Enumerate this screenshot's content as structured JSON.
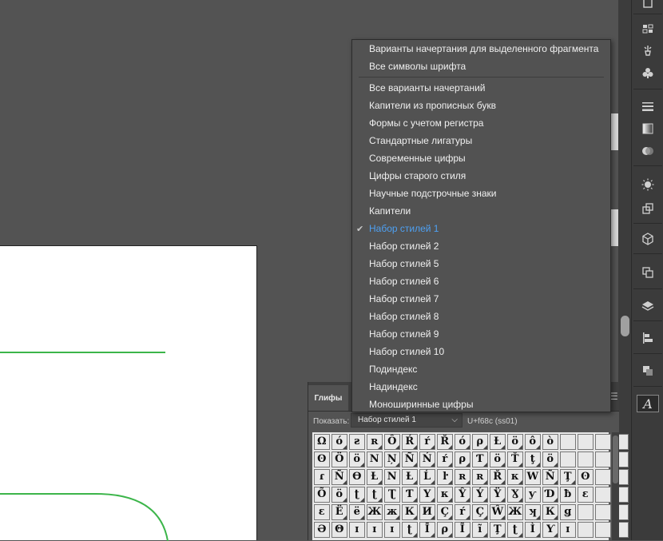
{
  "menu": {
    "items": [
      {
        "label": "Варианты начертания для выделенного фрагмента"
      },
      {
        "label": "Все символы шрифта"
      },
      {
        "label": "Все варианты начертаний"
      },
      {
        "label": "Капители из прописных букв"
      },
      {
        "label": "Формы с учетом регистра"
      },
      {
        "label": "Стандартные лигатуры"
      },
      {
        "label": "Современные цифры"
      },
      {
        "label": "Цифры старого стиля"
      },
      {
        "label": "Научные подстрочные знаки"
      },
      {
        "label": "Капители"
      },
      {
        "label": "Набор стилей 1",
        "checked": true
      },
      {
        "label": "Набор стилей 2"
      },
      {
        "label": "Набор стилей 5"
      },
      {
        "label": "Набор стилей 6"
      },
      {
        "label": "Набор стилей 7"
      },
      {
        "label": "Набор стилей 8"
      },
      {
        "label": "Набор стилей 9"
      },
      {
        "label": "Набор стилей 10"
      },
      {
        "label": "Подиндекс"
      },
      {
        "label": "Надиндекс"
      },
      {
        "label": "Моноширинные цифры"
      }
    ],
    "check_glyph": "✔",
    "accent_color": "#4ea0f2"
  },
  "glyphs_panel": {
    "tab_label": "Глифы",
    "show_label": "Показать:",
    "show_value": "Набор стилей 1",
    "unicode_info": "U+f68c (ss01)",
    "rows": [
      [
        "Ω",
        "ó",
        "ƨ",
        "ʀ",
        "Ô",
        "Ŕ",
        "ŕ",
        "Ř",
        "ó",
        "ρ",
        "Ƚ",
        "ö",
        "ô",
        "ò"
      ],
      [
        "ʘ",
        "Ö",
        "ö",
        "Ν",
        "Ņ",
        "Ñ",
        "Ń",
        "ŕ",
        "ρ",
        "Ƭ",
        "ö",
        "Ť",
        "ţ",
        "ö"
      ],
      [
        "ɾ",
        "Ñ",
        "Ѳ",
        "Ƚ",
        "Ν",
        "Ƚ",
        "Ĺ",
        "ŀ",
        "ʀ",
        "ʀ",
        "Ř",
        "κ",
        "W",
        "Ñ",
        "Ţ",
        "ʘ"
      ],
      [
        "Õ",
        "ö",
        "ʈ",
        "ʈ",
        "Ʈ",
        "Ƭ",
        "Υ",
        "κ",
        "Ŷ",
        "Ý",
        "Ÿ",
        "Ɣ",
        "ƴ",
        "Ɗ",
        "ƀ",
        "ɛ"
      ],
      [
        "ɛ",
        "Ë",
        "ë",
        "Ж",
        "ж",
        "К",
        "И",
        "Ç",
        "ŕ",
        "Ç",
        "Ŵ",
        "Ж",
        "ʞ",
        "К",
        "ǥ"
      ],
      [
        "Ə",
        "Θ",
        "ɪ",
        "ɪ",
        "ɪ",
        "ʈ",
        "Ī",
        "ρ",
        "Ĩ",
        "ĩ",
        "Ţ",
        "ʈ",
        "Ì",
        "Ƴ",
        "ɪ"
      ]
    ],
    "marked": [
      "ó",
      "ʀ",
      "Ô",
      "Ŕ",
      "ŕ",
      "Ř",
      "ó",
      "ρ",
      "Ƚ",
      "ö",
      "ô",
      "Ņ",
      "Ñ",
      "Ń",
      "ŕ",
      "Ƭ",
      "Ť",
      "ţ",
      "Ĺ",
      "ŀ",
      "Ř",
      "κ",
      "Ţ",
      "Ƭ",
      "Υ",
      "κ",
      "Ŷ",
      "Ý",
      "Ÿ",
      "Ɣ",
      "Ɗ",
      "Ë",
      "ë",
      "ж",
      "К",
      "И",
      "Ç",
      "Ŵ",
      "ʞ",
      "Ī",
      "Ĩ",
      "ĩ",
      "ʈ",
      "Ì",
      "Ƴ"
    ]
  },
  "tools": [
    {
      "name": "libraries-icon"
    },
    {
      "name": "swatches-grid-icon"
    },
    {
      "name": "brush-icon"
    },
    {
      "name": "club-symbol-icon"
    },
    {
      "name": "stroke-lines-icon"
    },
    {
      "name": "gradient-icon"
    },
    {
      "name": "transparency-icon"
    },
    {
      "name": "appearance-sun-icon"
    },
    {
      "name": "graphic-styles-icon"
    },
    {
      "name": "3d-cube-icon"
    },
    {
      "name": "artboards-icon"
    },
    {
      "name": "layers-icon"
    },
    {
      "name": "align-icon"
    },
    {
      "name": "pathfinder-icon"
    },
    {
      "name": "glyphs-italic-a-icon"
    }
  ],
  "canvas": {
    "green_stroke": "#3cb54a"
  }
}
